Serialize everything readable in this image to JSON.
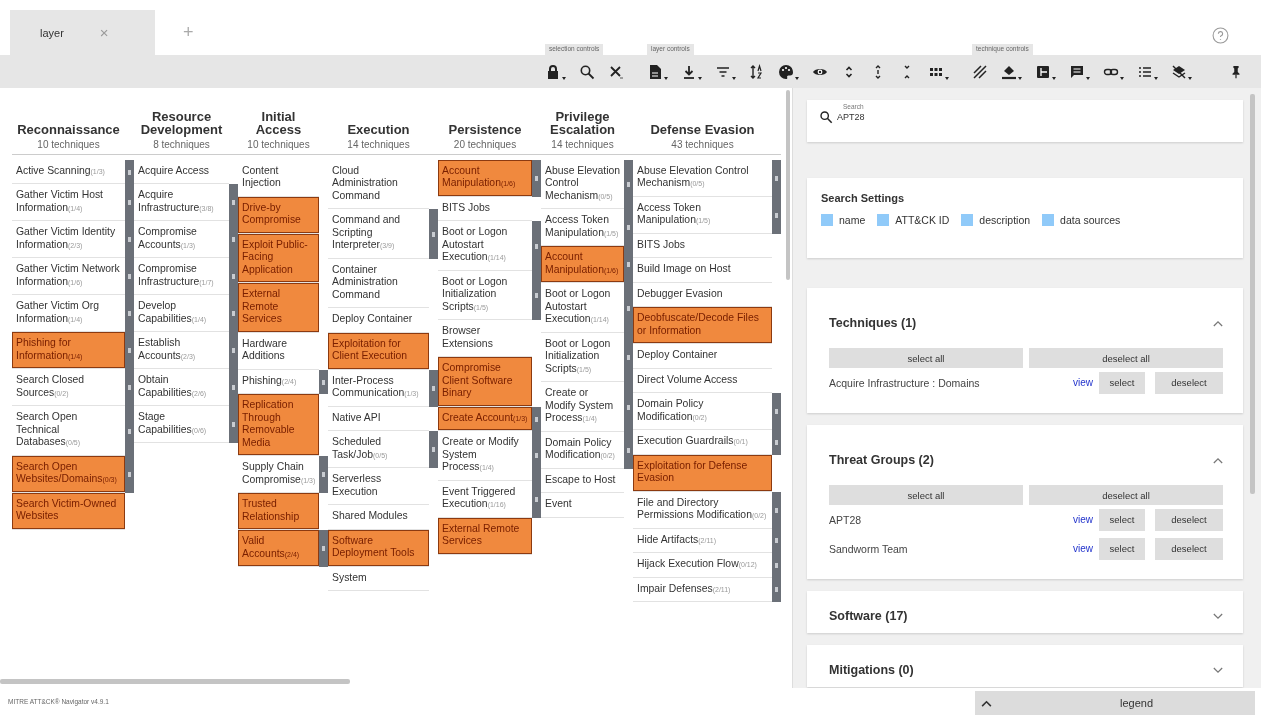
{
  "tabs": [
    {
      "label": "layer",
      "selected": true,
      "close": "×"
    }
  ],
  "new_tab": "+",
  "toolbar_groups": [
    {
      "label": "selection controls"
    },
    {
      "label": "layer controls"
    },
    {
      "label": "technique controls"
    }
  ],
  "tactics": [
    {
      "name": "Reconnaissance",
      "count": "10 techniques",
      "techniques": [
        {
          "name": "Active Scanning",
          "count": "(1/3)",
          "highlighted": false
        },
        {
          "name": "Gather Victim Host Information",
          "count": "(1/4)",
          "highlighted": false
        },
        {
          "name": "Gather Victim Identity Information",
          "count": "(2/3)",
          "highlighted": false
        },
        {
          "name": "Gather Victim Network Information",
          "count": "(1/6)",
          "highlighted": false
        },
        {
          "name": "Gather Victim Org Information",
          "count": "(1/4)",
          "highlighted": false
        },
        {
          "name": "Phishing for Information",
          "count": "(1/4)",
          "highlighted": true
        },
        {
          "name": "Search Closed Sources",
          "count": "(0/2)",
          "highlighted": false
        },
        {
          "name": "Search Open Technical Databases",
          "count": "(0/5)",
          "highlighted": false
        },
        {
          "name": "Search Open Websites/Domains",
          "count": "(0/3)",
          "highlighted": true
        },
        {
          "name": "Search Victim-Owned Websites",
          "highlighted": true
        }
      ]
    },
    {
      "name": "Resource Development",
      "count": "8 techniques",
      "techniques": [
        {
          "name": "Acquire Access",
          "highlighted": false
        },
        {
          "name": "Acquire Infrastructure",
          "count": "(3/8)",
          "highlighted": false
        },
        {
          "name": "Compromise Accounts",
          "count": "(1/3)",
          "highlighted": false
        },
        {
          "name": "Compromise Infrastructure",
          "count": "(1/7)",
          "highlighted": false
        },
        {
          "name": "Develop Capabilities",
          "count": "(1/4)",
          "highlighted": false
        },
        {
          "name": "Establish Accounts",
          "count": "(2/3)",
          "highlighted": false
        },
        {
          "name": "Obtain Capabilities",
          "count": "(2/6)",
          "highlighted": false
        },
        {
          "name": "Stage Capabilities",
          "count": "(0/6)",
          "highlighted": false
        }
      ]
    },
    {
      "name": "Initial Access",
      "count": "10 techniques",
      "techniques": [
        {
          "name": "Content Injection",
          "highlighted": false
        },
        {
          "name": "Drive-by Compromise",
          "highlighted": true
        },
        {
          "name": "Exploit Public-Facing Application",
          "highlighted": true
        },
        {
          "name": "External Remote Services",
          "highlighted": true
        },
        {
          "name": "Hardware Additions",
          "highlighted": false
        },
        {
          "name": "Phishing",
          "count": "(2/4)",
          "highlighted": false
        },
        {
          "name": "Replication Through Removable Media",
          "highlighted": true
        },
        {
          "name": "Supply Chain Compromise",
          "count": "(1/3)",
          "highlighted": false
        },
        {
          "name": "Trusted Relationship",
          "highlighted": true
        },
        {
          "name": "Valid Accounts",
          "count": "(2/4)",
          "highlighted": true
        }
      ]
    },
    {
      "name": "Execution",
      "count": "14 techniques",
      "techniques": [
        {
          "name": "Cloud Administration Command",
          "highlighted": false
        },
        {
          "name": "Command and Scripting Interpreter",
          "count": "(3/9)",
          "highlighted": false
        },
        {
          "name": "Container Administration Command",
          "highlighted": false
        },
        {
          "name": "Deploy Container",
          "highlighted": false
        },
        {
          "name": "Exploitation for Client Execution",
          "highlighted": true
        },
        {
          "name": "Inter-Process Communication",
          "count": "(1/3)",
          "highlighted": false
        },
        {
          "name": "Native API",
          "highlighted": false
        },
        {
          "name": "Scheduled Task/Job",
          "count": "(0/5)",
          "highlighted": false
        },
        {
          "name": "Serverless Execution",
          "highlighted": false
        },
        {
          "name": "Shared Modules",
          "highlighted": false
        },
        {
          "name": "Software Deployment Tools",
          "highlighted": true
        },
        {
          "name": "System",
          "highlighted": false
        }
      ]
    },
    {
      "name": "Persistence",
      "count": "20 techniques",
      "techniques": [
        {
          "name": "Account Manipulation",
          "count": "(1/6)",
          "highlighted": true
        },
        {
          "name": "BITS Jobs",
          "highlighted": false
        },
        {
          "name": "Boot or Logon Autostart Execution",
          "count": "(1/14)",
          "highlighted": false
        },
        {
          "name": "Boot or Logon Initialization Scripts",
          "count": "(1/5)",
          "highlighted": false
        },
        {
          "name": "Browser Extensions",
          "highlighted": false
        },
        {
          "name": "Compromise Client Software Binary",
          "highlighted": true
        },
        {
          "name": "Create Account",
          "count": "(1/3)",
          "highlighted": true
        },
        {
          "name": "Create or Modify System Process",
          "count": "(1/4)",
          "highlighted": false
        },
        {
          "name": "Event Triggered Execution",
          "count": "(1/16)",
          "highlighted": false
        },
        {
          "name": "External Remote Services",
          "highlighted": true
        }
      ]
    },
    {
      "name": "Privilege Escalation",
      "count": "14 techniques",
      "techniques": [
        {
          "name": "Abuse Elevation Control Mechanism",
          "count": "(0/5)",
          "highlighted": false
        },
        {
          "name": "Access Token Manipulation",
          "count": "(1/5)",
          "highlighted": false
        },
        {
          "name": "Account Manipulation",
          "count": "(1/6)",
          "highlighted": true
        },
        {
          "name": "Boot or Logon Autostart Execution",
          "count": "(1/14)",
          "highlighted": false
        },
        {
          "name": "Boot or Logon Initialization Scripts",
          "count": "(1/5)",
          "highlighted": false
        },
        {
          "name": "Create or Modify System Process",
          "count": "(1/4)",
          "highlighted": false
        },
        {
          "name": "Domain Policy Modification",
          "count": "(0/2)",
          "highlighted": false
        },
        {
          "name": "Escape to Host",
          "highlighted": false
        },
        {
          "name": "Event",
          "highlighted": false
        }
      ]
    },
    {
      "name": "Defense Evasion",
      "count": "43 techniques",
      "techniques": [
        {
          "name": "Abuse Elevation Control Mechanism",
          "count": "(0/5)",
          "highlighted": false
        },
        {
          "name": "Access Token Manipulation",
          "count": "(1/5)",
          "highlighted": false
        },
        {
          "name": "BITS Jobs",
          "highlighted": false
        },
        {
          "name": "Build Image on Host",
          "highlighted": false
        },
        {
          "name": "Debugger Evasion",
          "highlighted": false
        },
        {
          "name": "Deobfuscate/Decode Files or Information",
          "highlighted": true
        },
        {
          "name": "Deploy Container",
          "highlighted": false
        },
        {
          "name": "Direct Volume Access",
          "highlighted": false
        },
        {
          "name": "Domain Policy Modification",
          "count": "(0/2)",
          "highlighted": false
        },
        {
          "name": "Execution Guardrails",
          "count": "(0/1)",
          "highlighted": false
        },
        {
          "name": "Exploitation for Defense Evasion",
          "highlighted": true
        },
        {
          "name": "File and Directory Permissions Modification",
          "count": "(0/2)",
          "highlighted": false
        },
        {
          "name": "Hide Artifacts",
          "count": "(2/11)",
          "highlighted": false
        },
        {
          "name": "Hijack Execution Flow",
          "count": "(0/12)",
          "highlighted": false
        },
        {
          "name": "Impair Defenses",
          "count": "(2/11)",
          "highlighted": false
        }
      ]
    }
  ],
  "search": {
    "label": "Search",
    "value": "APT28"
  },
  "search_settings": {
    "title": "Search Settings",
    "options": [
      {
        "label": "name",
        "checked": true
      },
      {
        "label": "ATT&CK ID",
        "checked": true
      },
      {
        "label": "description",
        "checked": true
      },
      {
        "label": "data sources",
        "checked": true
      }
    ]
  },
  "sections": [
    {
      "title": "Techniques (1)",
      "expanded": true,
      "select_all": "select all",
      "deselect_all": "deselect all",
      "items": [
        {
          "name": "Acquire Infrastructure : Domains",
          "view": "view",
          "select": "select",
          "deselect": "deselect"
        }
      ]
    },
    {
      "title": "Threat Groups (2)",
      "expanded": true,
      "select_all": "select all",
      "deselect_all": "deselect all",
      "items": [
        {
          "name": "APT28",
          "view": "view",
          "select": "select",
          "deselect": "deselect"
        },
        {
          "name": "Sandworm Team",
          "view": "view",
          "select": "select",
          "deselect": "deselect"
        }
      ]
    },
    {
      "title": "Software (17)",
      "expanded": false
    },
    {
      "title": "Mitigations (0)",
      "expanded": false
    }
  ],
  "footer": "MITRE ATT&CK® Navigator v4.9.1",
  "legend": {
    "label": "legend",
    "expanded": false
  }
}
